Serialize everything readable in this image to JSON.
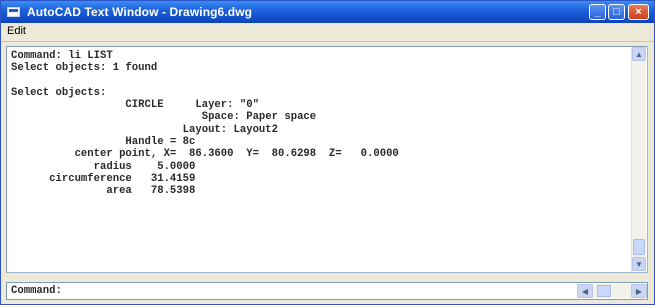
{
  "window": {
    "title": "AutoCAD Text Window - Drawing6.dwg"
  },
  "menu": {
    "items": [
      "Edit"
    ]
  },
  "text_window": {
    "lines": [
      "Command: li LIST",
      "Select objects: 1 found",
      "",
      "Select objects:",
      "                  CIRCLE     Layer: \"0\"",
      "                              Space: Paper space",
      "                           Layout: Layout2",
      "                  Handle = 8c",
      "          center point, X=  86.3600  Y=  80.6298  Z=   0.0000",
      "             radius    5.0000",
      "      circumference   31.4159",
      "               area   78.5398"
    ]
  },
  "command_line": {
    "prompt": "Command:"
  },
  "colors": {
    "title_bar": "#1d63dd",
    "close_button": "#c8401e",
    "window_face": "#ece9d8"
  }
}
